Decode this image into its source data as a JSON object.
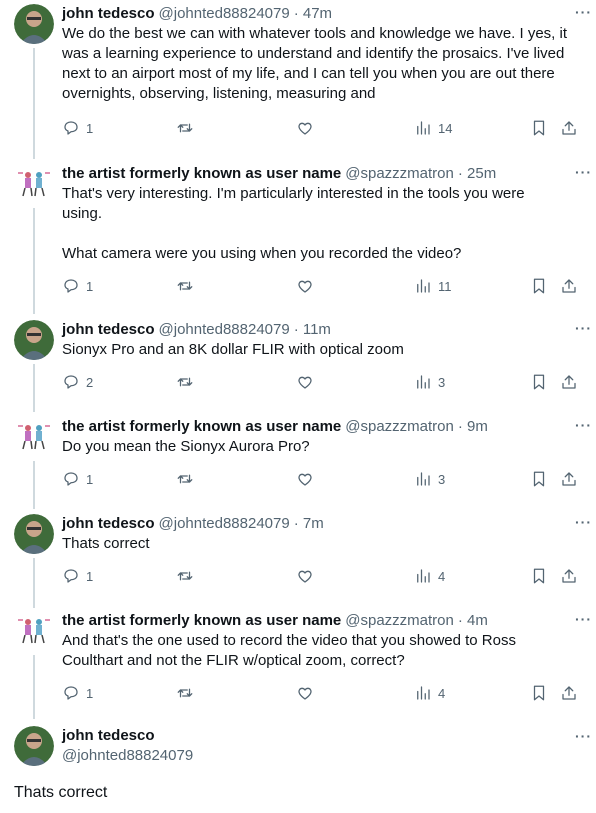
{
  "tweets": [
    {
      "name": "john tedesco",
      "handle": "@johnted88824079",
      "time": "· 47m",
      "lines": [
        "We do the best we can with whatever tools and knowledge we have. I yes, it",
        "was a learning experience to understand and identify the prosaics. I've lived",
        "next to an airport most of my life, and I can tell you when you are out there",
        "overnights, observing, listening, measuring and"
      ],
      "replies": "1",
      "views": "14"
    },
    {
      "name": "the artist formerly known as user name",
      "handle": "@spazzzmatron",
      "time": "· 25m",
      "lines": [
        "That's very interesting. I'm particularly interested in the tools you were",
        "using.",
        "",
        "What camera were you using when you recorded the video?"
      ],
      "replies": "1",
      "views": "11"
    },
    {
      "name": "john tedesco",
      "handle": "@johnted88824079",
      "time": "· 11m",
      "lines": [
        "Sionyx Pro and an 8K dollar FLIR with optical zoom"
      ],
      "replies": "2",
      "views": "3"
    },
    {
      "name": "the artist formerly known as user name",
      "handle": "@spazzzmatron",
      "time": "· 9m",
      "lines": [
        "Do you mean the Sionyx Aurora Pro?"
      ],
      "replies": "1",
      "views": "3"
    },
    {
      "name": "john tedesco",
      "handle": "@johnted88824079",
      "time": "· 7m",
      "lines": [
        "Thats correct"
      ],
      "replies": "1",
      "views": "4"
    },
    {
      "name": "the artist formerly known as user name",
      "handle": "@spazzzmatron",
      "time": "· 4m",
      "lines": [
        "And that's the one used to record the video that you showed to Ross",
        "Coulthart and not the FLIR w/optical zoom, correct?"
      ],
      "replies": "1",
      "views": "4"
    }
  ],
  "main_tweet": {
    "name": "john tedesco",
    "handle": "@johnted88824079",
    "text": "Thats correct"
  },
  "more_label": "···",
  "colors": {
    "text": "#0f1419",
    "secondary": "#536471",
    "thread_line": "#cfd9de"
  },
  "icons": [
    "reply-icon",
    "retweet-icon",
    "like-icon",
    "views-icon",
    "bookmark-icon",
    "share-icon",
    "more-icon"
  ]
}
